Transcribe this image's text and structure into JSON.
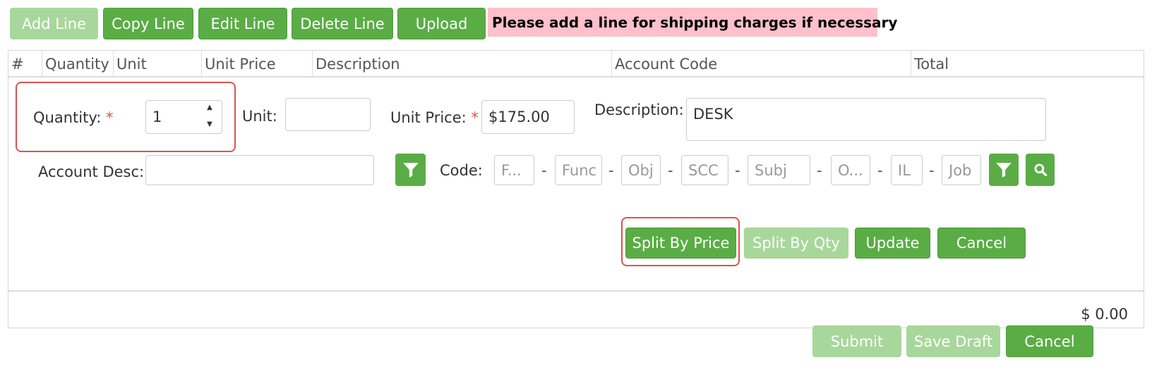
{
  "toolbar": {
    "add_line": "Add Line",
    "copy_line": "Copy Line",
    "edit_line": "Edit Line",
    "delete_line": "Delete Line",
    "upload": "Upload",
    "notice": "Please add a line for shipping charges if necessary"
  },
  "table": {
    "columns": [
      "#",
      "Quantity",
      "Unit",
      "Unit Price",
      "Description",
      "Account Code",
      "Total"
    ]
  },
  "form": {
    "quantity_label": "Quantity:",
    "quantity_value": "1",
    "unit_label": "Unit:",
    "unit_value": "",
    "unit_price_label": "Unit Price:",
    "unit_price_value": "$175.00",
    "description_label": "Description:",
    "description_value": "DESK",
    "required_mark": "*",
    "account_desc_label": "Account Desc:",
    "account_desc_value": "",
    "code_label": "Code:",
    "code_fields": {
      "fund": "F...",
      "func": "Func",
      "obj": "Obj",
      "scc": "SCC",
      "subj": "Subj",
      "org": "O...",
      "il": "IL",
      "job": "Job"
    },
    "dash": "-"
  },
  "line_actions": {
    "split_by_price": "Split By Price",
    "split_by_qty": "Split By Qty",
    "update": "Update",
    "cancel": "Cancel"
  },
  "grand_total": "$ 0.00",
  "footer": {
    "submit": "Submit",
    "save_draft": "Save Draft",
    "cancel": "Cancel"
  },
  "icons": {
    "filter": "filter-icon",
    "search": "search-icon",
    "spinner": "spinner-arrows-icon"
  },
  "colors": {
    "primary_green": "#5aad45",
    "disabled_green": "#a8d79b",
    "notice_bg": "#ffc0cb",
    "highlight_red": "#d9534f"
  }
}
